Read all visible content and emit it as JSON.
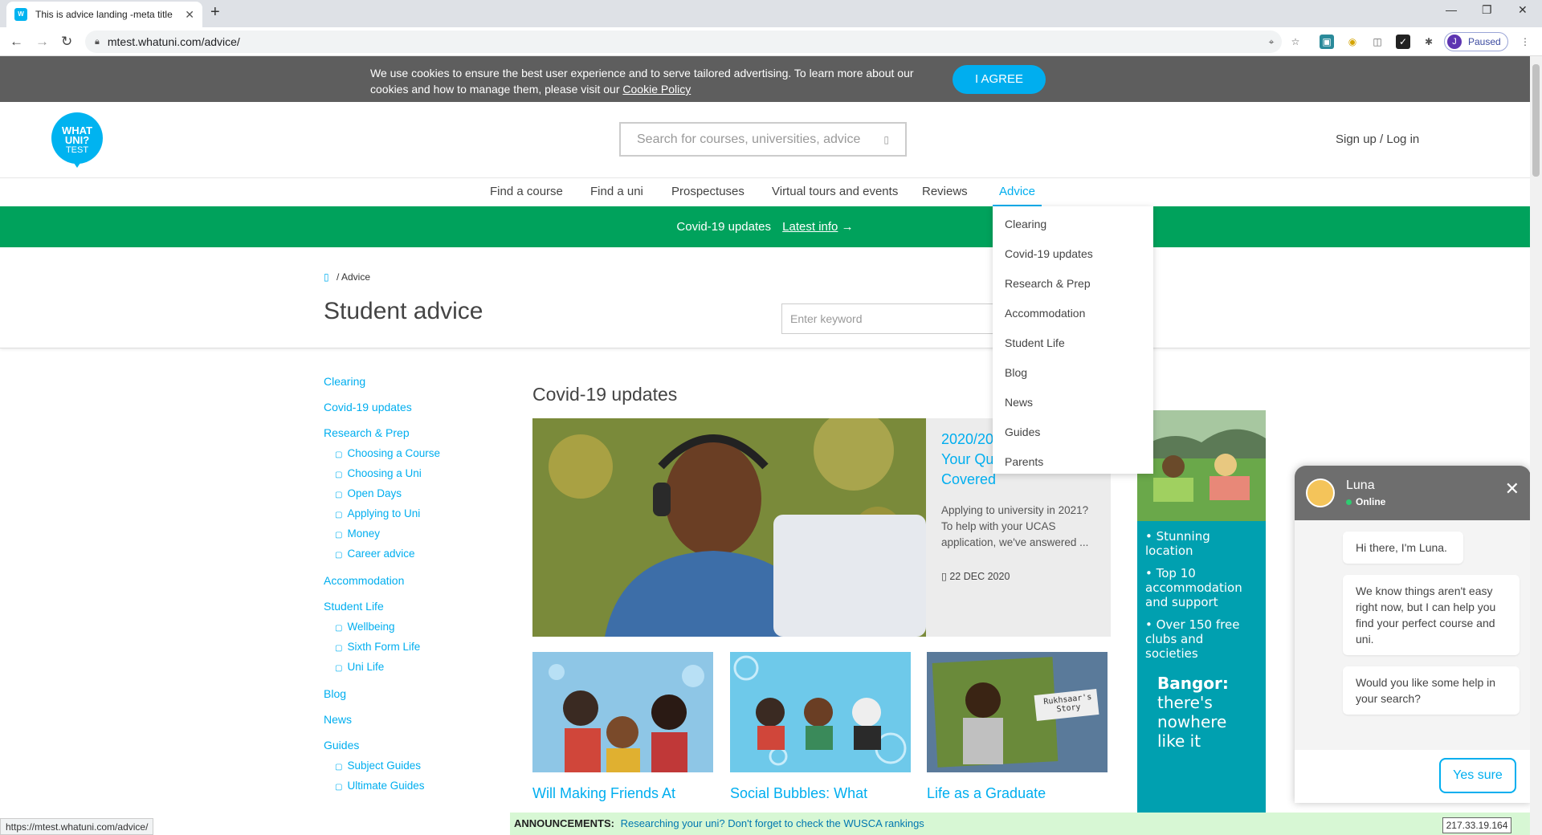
{
  "browser": {
    "tab_title": "This is advice landing -meta title",
    "url": "mtest.whatuni.com/advice/",
    "profile_label": "Paused",
    "profile_initial": "J"
  },
  "cookie": {
    "text": "We use cookies to ensure the best user experience and to serve tailored advertising. To learn more about our cookies and how to manage them, please visit our",
    "link": "Cookie Policy",
    "agree_label": "I AGREE"
  },
  "header": {
    "logo_line1": "WHAT",
    "logo_line2": "UNI?",
    "logo_line3": "TEST",
    "search_placeholder": "Search for courses, universities, advice",
    "signup_label": "Sign up / Log in"
  },
  "mainnav": {
    "items": [
      "Find a course",
      "Find a uni",
      "Prospectuses",
      "Virtual tours and events",
      "Reviews",
      "Advice"
    ]
  },
  "covid_bar": {
    "text": "Covid-19 updates",
    "link": "Latest info"
  },
  "hero": {
    "crumb": "Advice",
    "title": "Student advice",
    "keyword_placeholder": "Enter keyword"
  },
  "left_nav": {
    "clearing": "Clearing",
    "covid": "Covid-19 updates",
    "research": "Research & Prep",
    "research_sub": [
      "Choosing a Course",
      "Choosing a Uni",
      "Open Days",
      "Applying to Uni",
      "Money",
      "Career advice"
    ],
    "accommodation": "Accommodation",
    "student_life": "Student Life",
    "student_life_sub": [
      "Wellbeing",
      "Sixth Form Life",
      "Uni Life"
    ],
    "blog": "Blog",
    "news": "News",
    "guides": "Guides",
    "guides_sub": [
      "Subject Guides",
      "Ultimate Guides"
    ]
  },
  "content": {
    "section_title": "Covid-19 updates",
    "featured": {
      "title": "2020/2021 Applications: Your Questions Covered",
      "desc": "Applying to university in 2021? To help with your UCAS application, we've answered ...",
      "date": "22 DEC 2020"
    },
    "thumbs": [
      {
        "caption": "Will Making Friends At"
      },
      {
        "caption": "Social Bubbles: What"
      },
      {
        "caption": "Life as a Graduate",
        "tag": "Rukhsaar's Story"
      }
    ]
  },
  "advert": {
    "bullets": [
      "Stunning location",
      "Top 10 accommodation and support",
      "Over 150 free clubs and societies"
    ],
    "headline": "Bangor:",
    "tagline": "there's nowhere like it"
  },
  "dropdown": {
    "items": [
      "Clearing",
      "Covid-19 updates",
      "Research & Prep",
      "Accommodation",
      "Student Life",
      "Blog",
      "News",
      "Guides",
      "Parents"
    ]
  },
  "chat": {
    "name": "Luna",
    "status": "Online",
    "messages": [
      "Hi there, I'm Luna.",
      "We know things aren't easy right now, but I can help you find your perfect course and uni.",
      "Would you like some help in your search?"
    ],
    "reply_label": "Yes sure"
  },
  "announce": {
    "label": "ANNOUNCEMENTS:",
    "text": "Researching your uni? Don't forget to check the WUSCA rankings"
  },
  "status_url": "https://mtest.whatuni.com/advice/",
  "ip": "217.33.19.164",
  "colors": {
    "brand": "#00aeef",
    "covid_bar": "#00a25c",
    "advert": "#00a0b0",
    "announce": "#d7f7d4"
  }
}
